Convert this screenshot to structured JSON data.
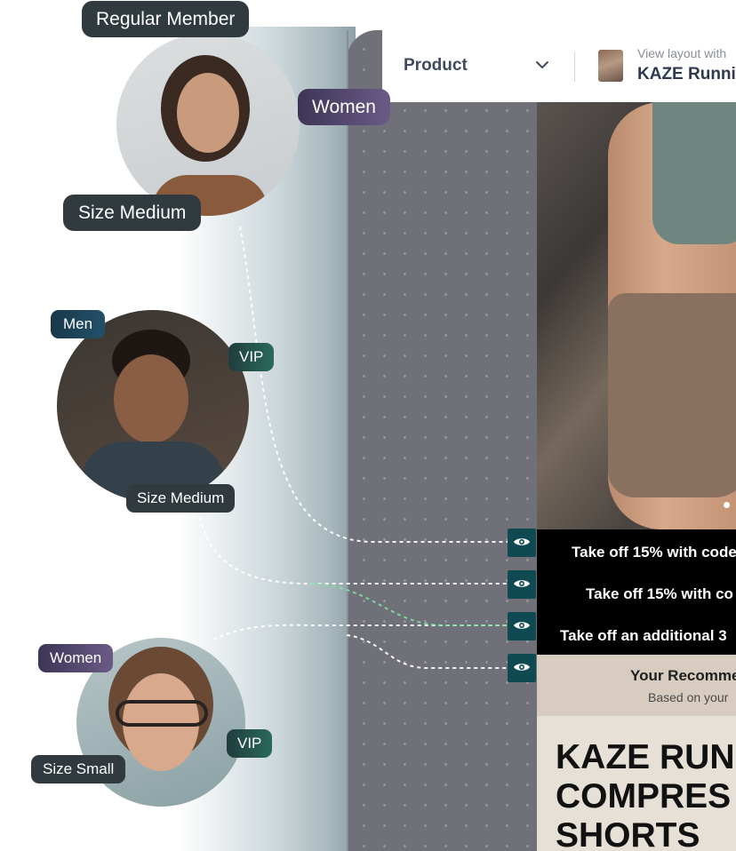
{
  "header": {
    "product_label": "Product",
    "view_layout_label": "View layout with",
    "product_name": "KAZE Runnin"
  },
  "personas": [
    {
      "name": "persona-regular-member",
      "tags": {
        "top": "Regular Member",
        "right": "Women",
        "bottom": "Size Medium"
      }
    },
    {
      "name": "persona-men-vip",
      "tags": {
        "top": "Men",
        "right": "VIP",
        "bottom": "Size Medium"
      }
    },
    {
      "name": "persona-women-vip",
      "tags": {
        "top": "Women",
        "right": "VIP",
        "bottom": "Size Small"
      }
    }
  ],
  "promos": [
    "Take off 15% with code",
    "Take off 15% with co",
    "Take off an additional 3"
  ],
  "recommendations": {
    "title": "Your Recomme",
    "subtitle": "Based on your"
  },
  "product_block": {
    "title_lines": [
      "KAZE RUN",
      "COMPRES",
      "SHORTS"
    ]
  },
  "icons": {
    "eye": "eye-icon",
    "chevron": "chevron-down-icon"
  },
  "colors": {
    "canvas": "#6f7078",
    "eye_button": "#0f4a52",
    "highlight_connector": "#7ee0a2"
  }
}
